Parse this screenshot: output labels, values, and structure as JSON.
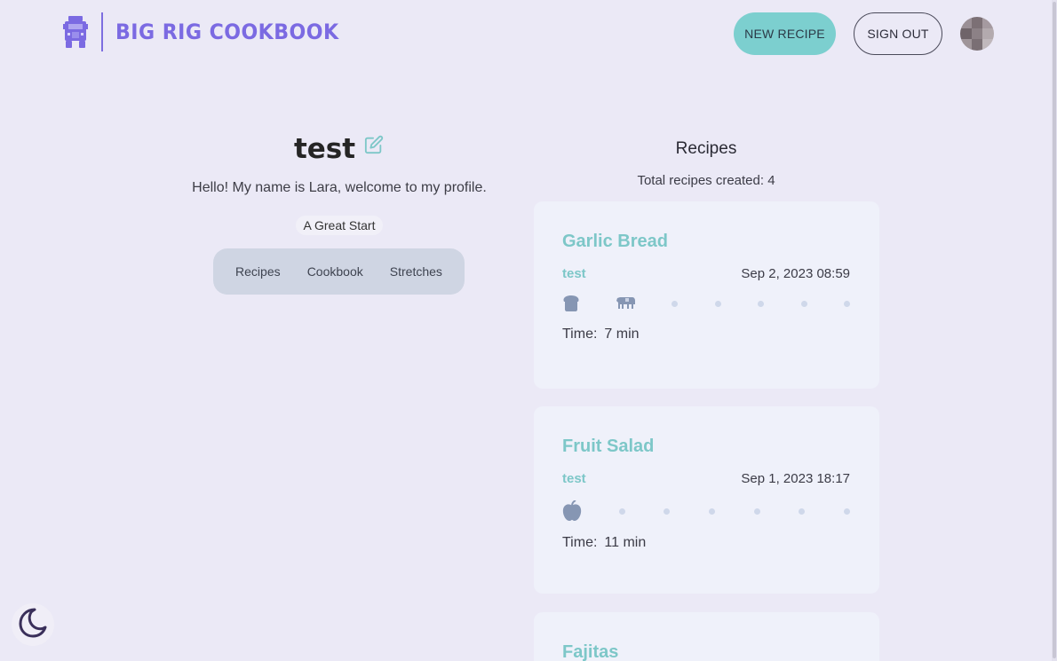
{
  "header": {
    "brand": "BIG RIG COOKBOOK",
    "logo_icon": "truck-icon",
    "new_recipe_label": "NEW RECIPE",
    "sign_out_label": "SIGN OUT",
    "avatar": "user-avatar"
  },
  "profile": {
    "name": "test",
    "edit_icon": "edit-icon",
    "bio": "Hello! My name is Lara, welcome to my profile.",
    "badge": "A Great Start",
    "tabs": [
      "Recipes",
      "Cookbook",
      "Stretches"
    ]
  },
  "recipes_section": {
    "title": "Recipes",
    "count_text": "Total recipes created: 4"
  },
  "recipes": [
    {
      "title": "Garlic Bread",
      "author": "test",
      "date": "Sep 2, 2023 08:59",
      "icons": [
        "bread-icon",
        "cow-icon"
      ],
      "time_label": "Time:",
      "time_value": "7 min"
    },
    {
      "title": "Fruit Salad",
      "author": "test",
      "date": "Sep 1, 2023 18:17",
      "icons": [
        "apple-icon"
      ],
      "time_label": "Time:",
      "time_value": "11 min"
    },
    {
      "title": "Fajitas"
    }
  ],
  "theme_toggle_icon": "moon-icon",
  "colors": {
    "background": "#ebe9f6",
    "brand": "#7b6ae2",
    "accent": "#7ccfcf",
    "card": "#eff1fa",
    "recipe_title": "#7dc7c8"
  }
}
